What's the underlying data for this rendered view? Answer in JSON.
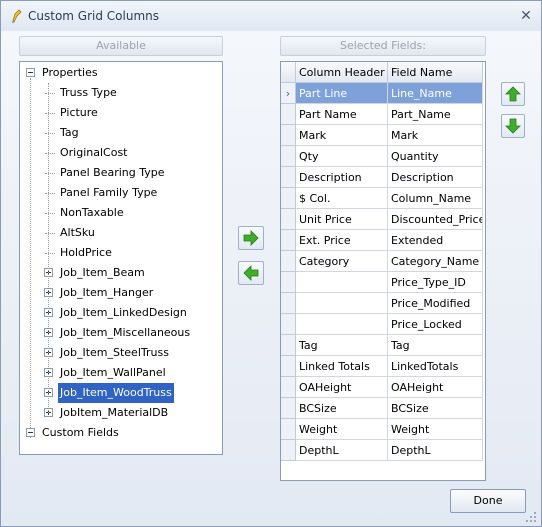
{
  "window": {
    "title": "Custom Grid Columns",
    "close_glyph": "✕"
  },
  "available": {
    "header": "Available",
    "root_properties": "Properties",
    "properties": [
      "Truss Type",
      "Picture",
      "Tag",
      "OriginalCost",
      "Panel Bearing Type",
      "Panel Family Type",
      "NonTaxable",
      "AltSku",
      "HoldPrice"
    ],
    "groups": [
      "Job_Item_Beam",
      "Job_Item_Hanger",
      "Job_Item_LinkedDesign",
      "Job_Item_Miscellaneous",
      "Job_Item_SteelTruss",
      "Job_Item_WallPanel",
      "Job_Item_WoodTruss",
      "JobItem_MaterialDB"
    ],
    "selected_group": "Job_Item_WoodTruss",
    "root_custom": "Custom Fields"
  },
  "selected": {
    "header": "Selected Fields:",
    "columns": [
      "Column Header",
      "Field Name"
    ],
    "rows": [
      [
        "Part Line",
        "Line_Name"
      ],
      [
        "Part Name",
        "Part_Name"
      ],
      [
        "Mark",
        "Mark"
      ],
      [
        "Qty",
        "Quantity"
      ],
      [
        "Description",
        "Description"
      ],
      [
        "$ Col.",
        "Column_Name"
      ],
      [
        "Unit Price",
        "Discounted_Price"
      ],
      [
        "Ext. Price",
        "Extended"
      ],
      [
        "Category",
        "Category_Name"
      ],
      [
        "",
        "Price_Type_ID"
      ],
      [
        "",
        "Price_Modified"
      ],
      [
        "",
        "Price_Locked"
      ],
      [
        "Tag",
        "Tag"
      ],
      [
        "Linked Totals",
        "LinkedTotals"
      ],
      [
        "OAHeight",
        "OAHeight"
      ],
      [
        "BCSize",
        "BCSize"
      ],
      [
        "Weight",
        "Weight"
      ],
      [
        "DepthL",
        "DepthL"
      ]
    ],
    "active_row_marker": "›"
  },
  "buttons": {
    "done": "Done"
  },
  "icons": {
    "title": "pencil-icon",
    "add": "arrow-right-icon",
    "remove": "arrow-left-icon",
    "move_up": "arrow-up-icon",
    "move_down": "arrow-down-icon"
  },
  "colors": {
    "selection": "#2f64c4",
    "active_row": "#7ea1d9",
    "arrow_green": "#3fae2a"
  }
}
